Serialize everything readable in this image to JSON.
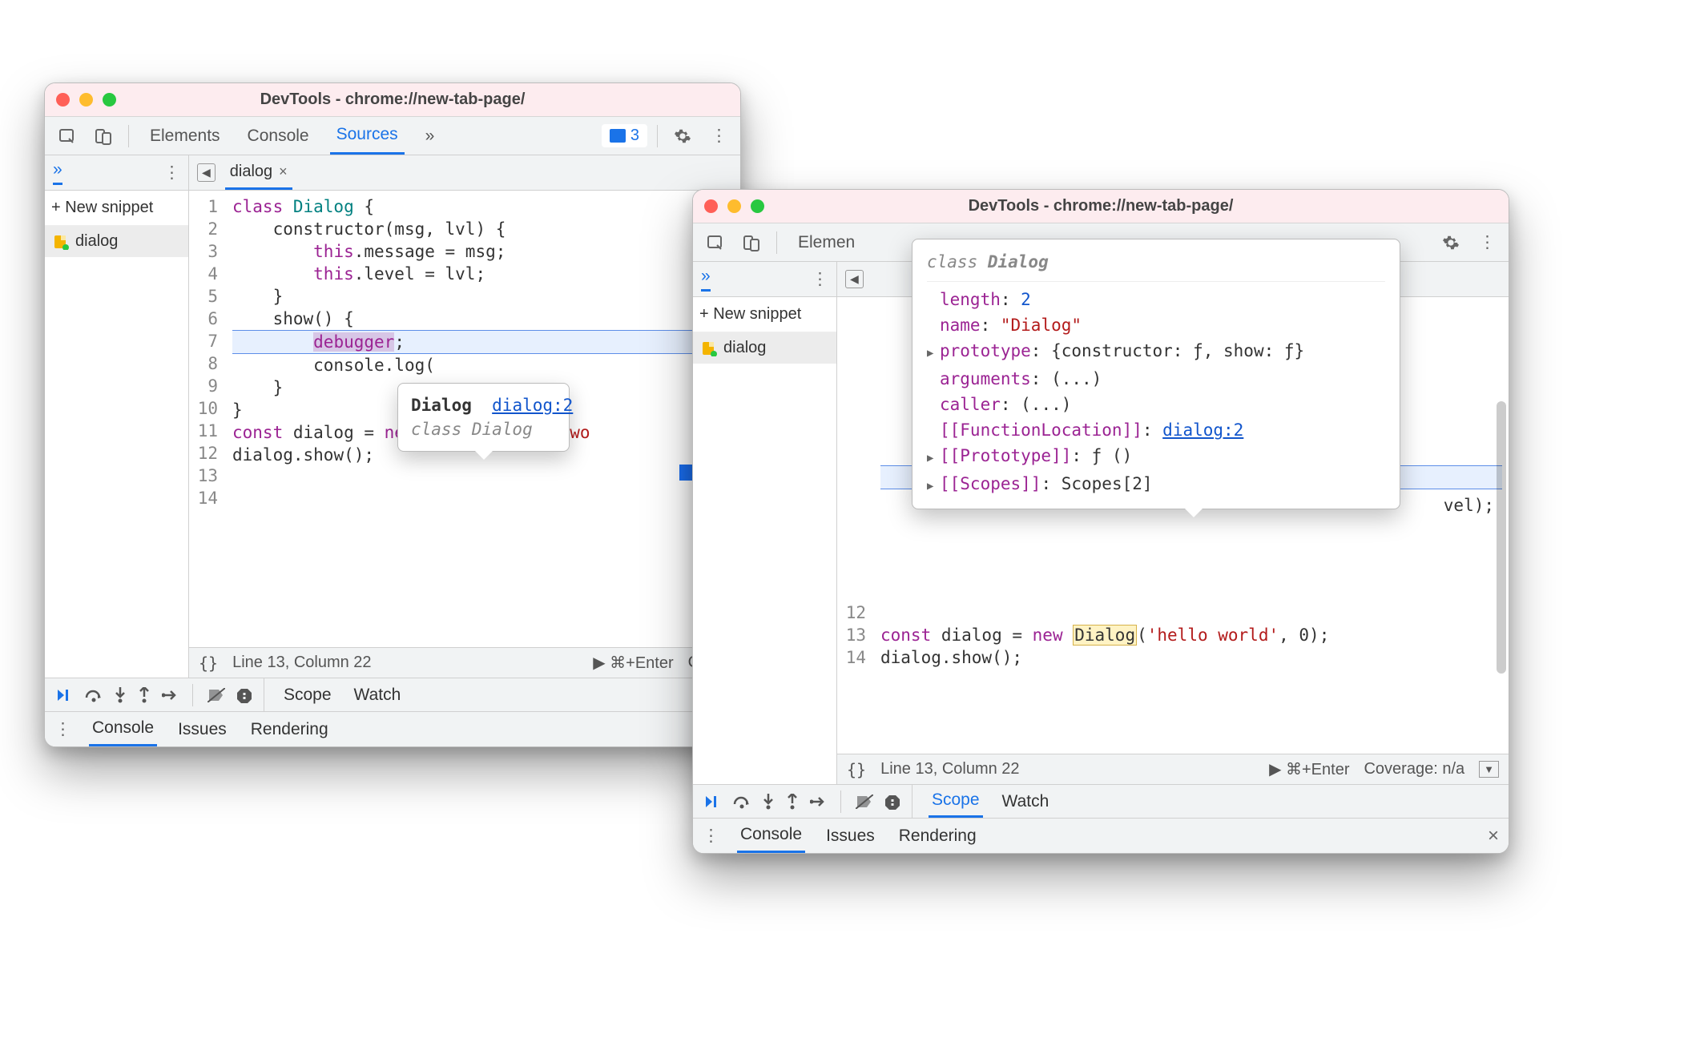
{
  "window_title": "DevTools - chrome://new-tab-page/",
  "toolbar": {
    "tabs": [
      "Elements",
      "Console",
      "Sources"
    ],
    "tab_elements_short": "Elemen",
    "active_tab": "Sources",
    "more": "»",
    "issues": "3"
  },
  "subbar": {
    "chev": "»",
    "file_name": "dialog",
    "nav_prev": "◀"
  },
  "sidebar": {
    "new_snippet": "+ New snippet",
    "items": [
      {
        "name": "dialog"
      }
    ]
  },
  "code": {
    "lines": [
      {
        "n": 1,
        "seg": [
          {
            "t": "class ",
            "c": "kw"
          },
          {
            "t": "Dialog ",
            "c": "cls"
          },
          {
            "t": "{"
          }
        ]
      },
      {
        "n": 2,
        "seg": [
          {
            "t": "    "
          },
          {
            "t": "constructor",
            "c": "fn"
          },
          {
            "t": "(msg, lvl) {"
          }
        ]
      },
      {
        "n": 3,
        "seg": [
          {
            "t": "        "
          },
          {
            "t": "this",
            "c": "kw"
          },
          {
            "t": ".message = msg;"
          }
        ]
      },
      {
        "n": 4,
        "seg": [
          {
            "t": "        "
          },
          {
            "t": "this",
            "c": "kw"
          },
          {
            "t": ".level = lvl;"
          }
        ]
      },
      {
        "n": 5,
        "seg": [
          {
            "t": "    }"
          }
        ]
      },
      {
        "n": 6,
        "seg": [
          {
            "t": ""
          }
        ]
      },
      {
        "n": 7,
        "seg": [
          {
            "t": "    "
          },
          {
            "t": "show",
            "c": "fn"
          },
          {
            "t": "() {"
          }
        ]
      },
      {
        "n": 8,
        "seg": [
          {
            "t": "        "
          },
          {
            "t": "debugger",
            "c": "kw",
            "bg": "debug"
          },
          {
            "t": ";"
          }
        ],
        "hl": true
      },
      {
        "n": 9,
        "seg": [
          {
            "t": "        console."
          },
          {
            "t": "log",
            "c": "fn"
          },
          {
            "t": "("
          }
        ],
        "cut": true
      },
      {
        "n": 10,
        "seg": [
          {
            "t": "    }"
          }
        ]
      },
      {
        "n": 11,
        "seg": [
          {
            "t": "}"
          }
        ]
      },
      {
        "n": 12,
        "seg": [
          {
            "t": ""
          }
        ]
      },
      {
        "n": 13,
        "seg": [
          {
            "t": "const ",
            "c": "kw"
          },
          {
            "t": "dialog = "
          },
          {
            "t": "new ",
            "c": "kw"
          },
          {
            "t": "Dialog",
            "c": "hilite"
          },
          {
            "t": "("
          },
          {
            "t": "'hello wo",
            "c": "str"
          }
        ],
        "cut": true
      },
      {
        "n": 14,
        "seg": [
          {
            "t": "dialog."
          },
          {
            "t": "show",
            "c": "fn"
          },
          {
            "t": "();"
          }
        ]
      }
    ],
    "line13_full": {
      "n": 13,
      "prefix": "const ",
      "mid": "dialog = ",
      "new": "new ",
      "cls": "Dialog",
      "after": "(",
      "str": "'hello world'",
      "rest": ", 0);"
    },
    "line14": "dialog.show();",
    "line12_n": 12,
    "line13_n": 13,
    "line14_n": 14
  },
  "tooltip1": {
    "name": "Dialog",
    "link": "dialog:2",
    "sig": "class Dialog"
  },
  "bigtip": {
    "header": "class Dialog",
    "rows": [
      {
        "k": "length",
        "v": "2",
        "type": "num"
      },
      {
        "k": "name",
        "v": "\"Dialog\"",
        "type": "str"
      },
      {
        "k": "prototype",
        "v": "{constructor: ƒ, show: ƒ}",
        "tri": true
      },
      {
        "k": "arguments",
        "v": "(...)"
      },
      {
        "k": "caller",
        "v": "(...)"
      },
      {
        "k": "[[FunctionLocation]]",
        "v": "dialog:2",
        "link": true
      },
      {
        "k": "[[Prototype]]",
        "v": "ƒ ()",
        "tri": true
      },
      {
        "k": "[[Scopes]]",
        "v": "Scopes[2]",
        "tri": true
      }
    ]
  },
  "status": {
    "braces": "{}",
    "pos": "Line 13, Column 22",
    "run": "▶ ⌘+Enter",
    "cover": "Cover",
    "coverage_full": "Coverage: n/a"
  },
  "debug_tabs": {
    "scope": "Scope",
    "watch": "Watch"
  },
  "drawer": {
    "tabs": [
      "Console",
      "Issues",
      "Rendering"
    ],
    "active": "Console"
  },
  "right_frag": {
    "level": "vel);"
  }
}
